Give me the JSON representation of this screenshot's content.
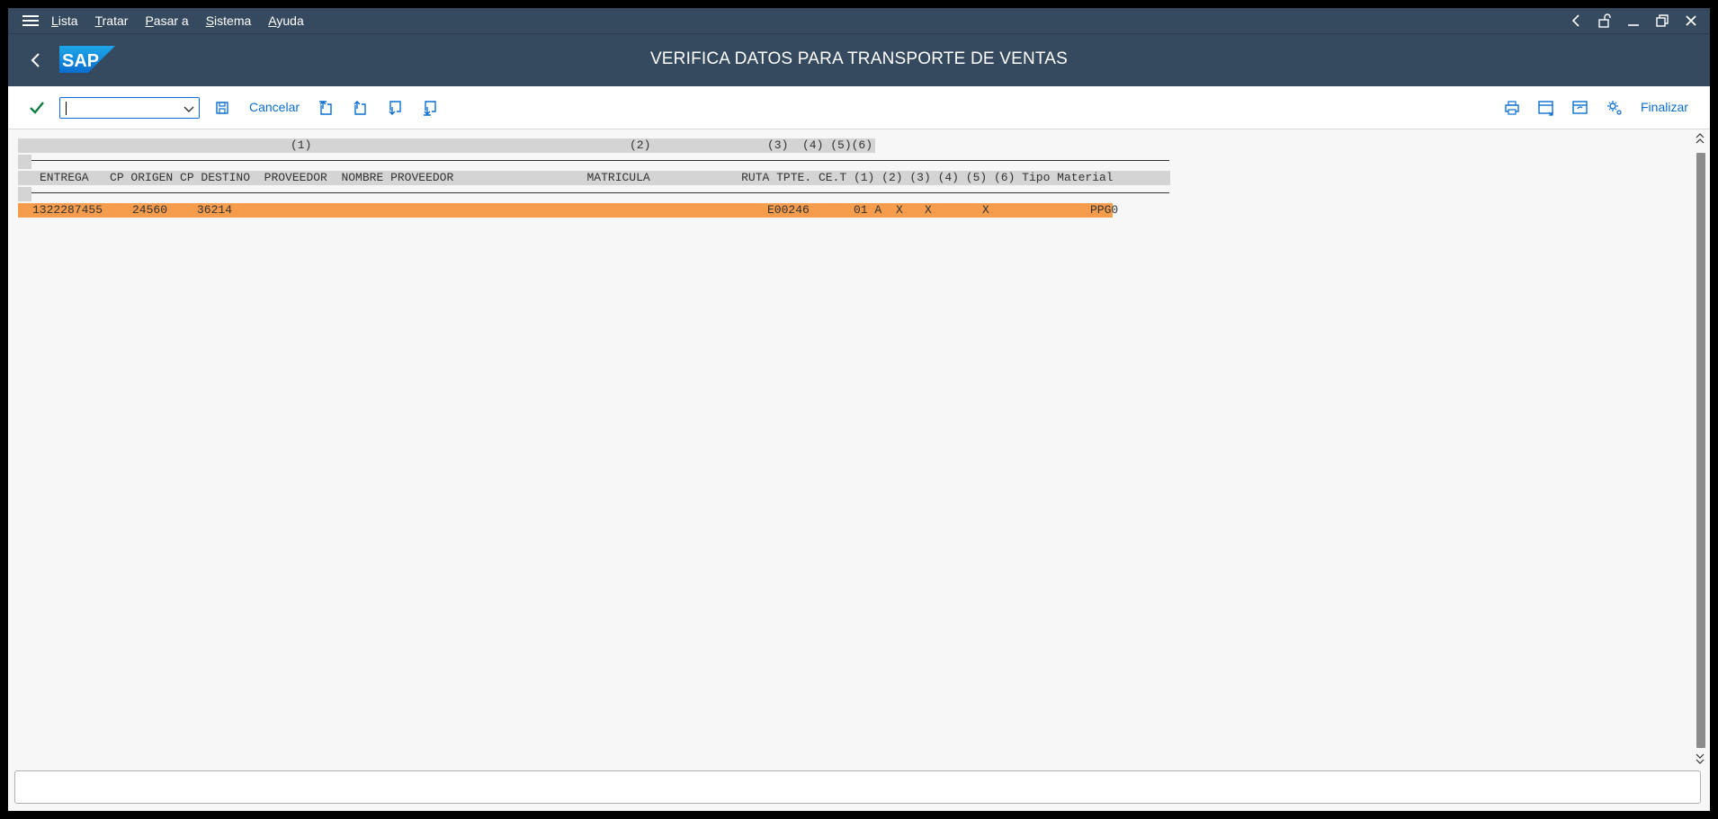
{
  "menubar": {
    "items": [
      {
        "label": "Lista"
      },
      {
        "label": "Tratar"
      },
      {
        "label": "Pasar a"
      },
      {
        "label": "Sistema"
      },
      {
        "label": "Ayuda"
      }
    ]
  },
  "title": {
    "text": "VERIFICA DATOS PARA TRANSPORTE DE VENTAS",
    "logo_text": "SAP"
  },
  "toolbar": {
    "command_value": "",
    "cancel_label": "Cancelar",
    "finish_label": "Finalizar"
  },
  "list": {
    "legend_row": {
      "c1": "(1)",
      "c2": "(2)",
      "c3": "(3)  (4) (5)(6)"
    },
    "header_row": "ENTREGA   CP ORIGEN CP DESTINO  PROVEEDOR  NOMBRE PROVEEDOR                   MATRICULA             RUTA TPTE. CE.T (1) (2) (3) (4) (5) (6) Tipo Material",
    "data_rows": [
      {
        "entrega": "1322287455",
        "cp_origen": "24560",
        "cp_destino": "36214",
        "ruta": "E00246",
        "cet": "01 A",
        "m1": "X",
        "m2": "X",
        "m4": "X",
        "tipo_material": "PPG0"
      }
    ]
  },
  "colors": {
    "shell": "#354a5f",
    "accent": "#0a6ed1",
    "highlight": "#f59c4d",
    "check": "#107e3e"
  }
}
